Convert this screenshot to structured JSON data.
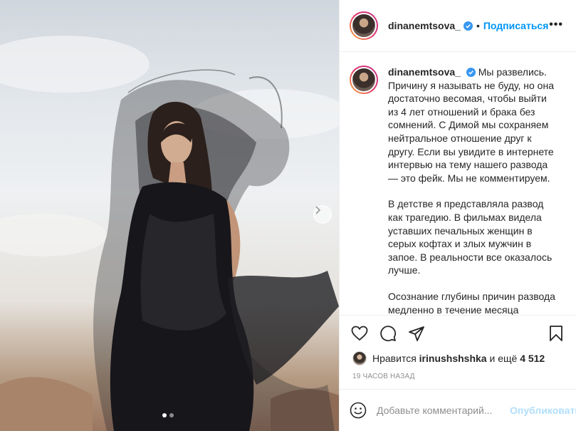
{
  "post": {
    "username": "dinanemtsova_",
    "follow_separator": "•",
    "follow_label": "Подписаться",
    "more_label": "•••",
    "caption_paragraphs": [
      "Мы развелись. Причину я называть не буду, но она достаточно весомая, чтобы выйти из 4 лет отношений и брака без сомнений. С Димой мы сохраняем нейтральное отношение друг к другу. Если вы увидите в интернете интервью на тему нашего развода — это фейк. Мы не комментируем.",
      "В детстве я представляла развод как трагедию. В фильмах видела уставших печальных женщин в серых кофтах и злых мужчин в запое. В реальности все оказалось лучше.",
      "Осознание глубины причин развода медленно в течение месяца"
    ],
    "likes_prefix": "Нравится",
    "liked_by": "irinushshshka",
    "likes_suffix_word": "и ещё",
    "likes_count": "4 512",
    "timestamp": "19 ЧАСОВ НАЗАД",
    "comment_placeholder": "Добавьте комментарий...",
    "publish_label": "Опубликовать"
  },
  "carousel": {
    "current": 1,
    "total": 2
  },
  "colors": {
    "accent": "#0095f6",
    "publish_disabled": "#b2dffc",
    "verified": "#3897f0"
  },
  "icons": [
    "verified-badge-icon",
    "heart-icon",
    "comment-icon",
    "share-icon",
    "bookmark-icon",
    "emoji-icon",
    "chevron-right-icon"
  ]
}
